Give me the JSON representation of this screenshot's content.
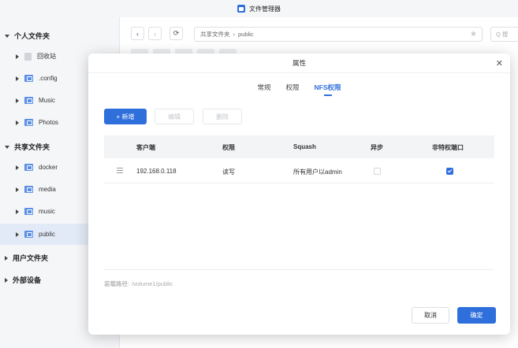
{
  "window": {
    "title": "文件管理器"
  },
  "sidebar": {
    "groups": [
      {
        "label": "个人文件夹",
        "expanded": true
      },
      {
        "label": "共享文件夹",
        "expanded": true
      },
      {
        "label": "用户文件夹",
        "expanded": false
      },
      {
        "label": "外部设备",
        "expanded": false
      }
    ],
    "personal": [
      "回收站",
      ".config",
      "Music",
      "Photos"
    ],
    "shared": [
      "docker",
      "media",
      "music",
      "public"
    ],
    "active_item": "public"
  },
  "main": {
    "path_root": "共享文件夹",
    "path_leaf": "public",
    "search_placeholder": "Q 搜"
  },
  "dialog": {
    "title": "属性",
    "tabs": [
      {
        "label": "常规",
        "active": false
      },
      {
        "label": "权限",
        "active": false
      },
      {
        "label": "NFS权限",
        "active": true
      }
    ],
    "buttons": {
      "add": "+ 新增",
      "edit": "编辑",
      "delete": "删除"
    },
    "table": {
      "headers": [
        "客户端",
        "权限",
        "Squash",
        "异步",
        "非特权端口"
      ],
      "rows": [
        {
          "client": "192.168.0.118",
          "permission": "读写",
          "squash": "所有用户以admin",
          "async": false,
          "insecure_port": true
        }
      ]
    },
    "mount_label": "装载路径:",
    "mount_path": "/volume1/public",
    "footer": {
      "cancel": "取消",
      "ok": "确定"
    }
  },
  "colors": {
    "accent": "#2f6fdc",
    "folder": "#5a8fe6"
  }
}
